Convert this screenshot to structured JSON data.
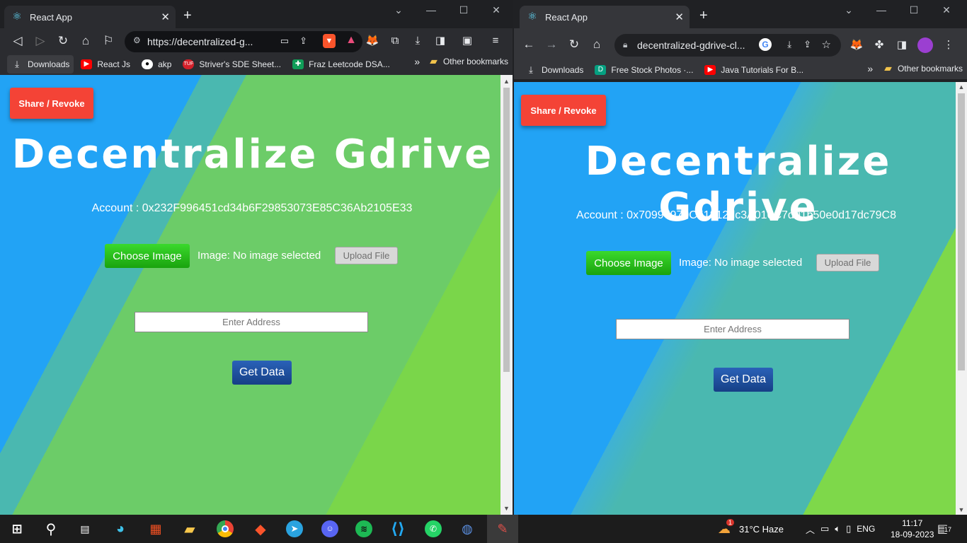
{
  "left_window": {
    "tab_title": "React App",
    "url": "https://decentralized-g...",
    "bookmarks": [
      {
        "label": "Downloads",
        "icon": "download-icon"
      },
      {
        "label": "React Js",
        "icon": "youtube-icon"
      },
      {
        "label": "akp",
        "icon": "github-icon"
      },
      {
        "label": "Striver's SDE Sheet...",
        "icon": "tuf-icon"
      },
      {
        "label": "Fraz Leetcode DSA...",
        "icon": "sheets-icon"
      }
    ],
    "other_bookmarks": "Other bookmarks",
    "more_chevron": "»",
    "app": {
      "share_label": "Share / Revoke",
      "title": "Decentralize Gdrive",
      "account": "Account : 0x232F996451cd34b6F29853073E85C36Ab2105E33",
      "choose_label": "Choose Image",
      "image_status": "Image: No image selected",
      "upload_label": "Upload File",
      "address_placeholder": "Enter Address",
      "getdata_label": "Get Data"
    }
  },
  "right_window": {
    "tab_title": "React App",
    "url": "decentralized-gdrive-cl...",
    "bookmarks": [
      {
        "label": "Downloads",
        "icon": "download-icon"
      },
      {
        "label": "Free Stock Photos ·...",
        "icon": "photos-icon"
      },
      {
        "label": "Java Tutorials For B...",
        "icon": "youtube-icon"
      }
    ],
    "other_bookmarks": "Other bookmarks",
    "more_chevron": "»",
    "app": {
      "share_label": "Share / Revoke",
      "title": "Decentralize Gdrive",
      "account": "Account : 0x70997970C51812dc3A010C7d01b50e0d17dc79C8",
      "choose_label": "Choose Image",
      "image_status": "Image: No image selected",
      "upload_label": "Upload File",
      "address_placeholder": "Enter Address",
      "getdata_label": "Get Data"
    }
  },
  "taskbar": {
    "weather": "31°C  Haze",
    "weather_badge": "1",
    "language": "ENG",
    "time": "11:17",
    "date": "18-09-2023",
    "notifications": "17",
    "apps": [
      "start-icon",
      "search-icon",
      "task-view-icon",
      "edge-icon",
      "store-icon",
      "file-explorer-icon",
      "chrome-icon",
      "brave-icon",
      "telegram-icon",
      "discord-icon",
      "spotify-icon",
      "vscode-icon",
      "whatsapp-icon",
      "webex-icon",
      "app-icon"
    ]
  },
  "colors": {
    "page_blue": "#22a3f5",
    "page_green": "#6cc96a",
    "page_lightgreen": "#7ed84a",
    "share_red": "#f44336",
    "choose_green": "#2bc11c",
    "getdata_blue": "#1f50a0"
  }
}
